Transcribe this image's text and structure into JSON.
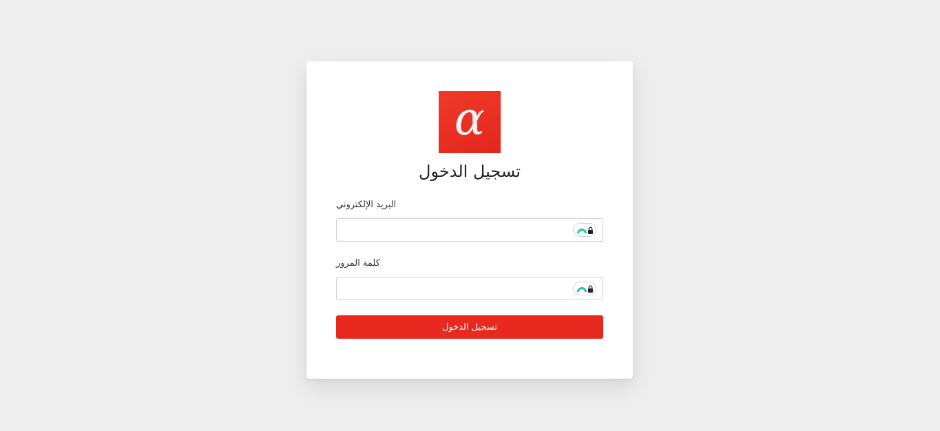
{
  "logo": {
    "glyph": "α",
    "icon": "alpha-logo-icon",
    "color": "#e8291f"
  },
  "login": {
    "title": "تسجيل الدخول",
    "email_label": "البريد الإلكتروني",
    "email_value": "",
    "password_label": "كلمة المرور",
    "password_value": "",
    "submit_label": "تسجيل الدخول"
  },
  "icons": {
    "field_extension": "password-manager-icon"
  },
  "colors": {
    "accent": "#e8291f",
    "background": "#eeeeee",
    "card": "#ffffff",
    "extension_teal": "#1fc7a6"
  }
}
